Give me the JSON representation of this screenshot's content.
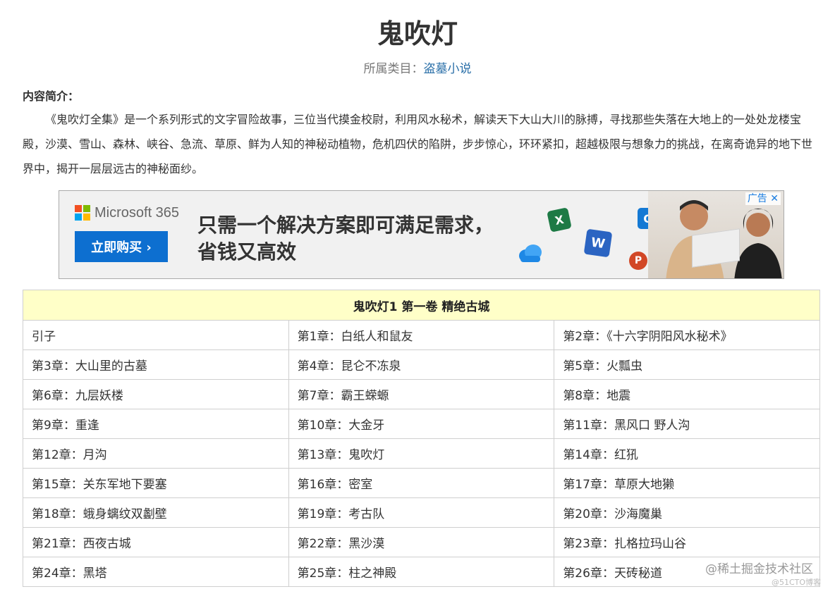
{
  "book": {
    "title": "鬼吹灯",
    "category_label": "所属类目：",
    "category_link": "盗墓小说"
  },
  "intro": {
    "heading": "内容简介：",
    "text": "《鬼吹灯全集》是一个系列形式的文字冒险故事，三位当代摸金校尉，利用风水秘术，解读天下大山大川的脉搏，寻找那些失落在大地上的一处处龙楼宝殿，沙漠、雪山、森林、峡谷、急流、草原、鲜为人知的神秘动植物，危机四伏的陷阱，步步惊心，环环紧扣，超越极限与想象力的挑战，在离奇诡异的地下世界中，揭开一层层远古的神秘面纱。"
  },
  "ad": {
    "brand": "Microsoft 365",
    "buy_button": "立即购买 ›",
    "slogan_line1": "只需一个解决方案即可满足需求，",
    "slogan_line2": "省钱又高效",
    "tag": "广告 ✕",
    "icon_excel": "X",
    "icon_word": "W",
    "icon_outlook": "O",
    "icon_powerpoint": "P"
  },
  "volume": {
    "title": "鬼吹灯1 第一卷 精绝古城",
    "rows": [
      [
        "引子",
        "第1章：白纸人和鼠友",
        "第2章：《十六字阴阳风水秘术》"
      ],
      [
        "第3章：大山里的古墓",
        "第4章：昆仑不冻泉",
        "第5章：火瓢虫"
      ],
      [
        "第6章：九层妖楼",
        "第7章：霸王蝾螈",
        "第8章：地震"
      ],
      [
        "第9章：重逢",
        "第10章：大金牙",
        "第11章：黑风口 野人沟"
      ],
      [
        "第12章：月沟",
        "第13章：鬼吹灯",
        "第14章：红犼"
      ],
      [
        "第15章：关东军地下要塞",
        "第16章：密室",
        "第17章：草原大地獭"
      ],
      [
        "第18章：蛾身螭纹双劙壁",
        "第19章：考古队",
        "第20章：沙海魔巢"
      ],
      [
        "第21章：西夜古城",
        "第22章：黑沙漠",
        "第23章：扎格拉玛山谷"
      ],
      [
        "第24章：黑塔",
        "第25章：柱之神殿",
        "第26章：天砖秘道"
      ]
    ]
  },
  "watermark": {
    "main": "@稀土掘金技术社区",
    "sub": "@51CTO博客"
  },
  "colors": {
    "link": "#2a6fa8",
    "table_header_bg": "#ffffc8",
    "ad_button": "#0d6fd0"
  }
}
